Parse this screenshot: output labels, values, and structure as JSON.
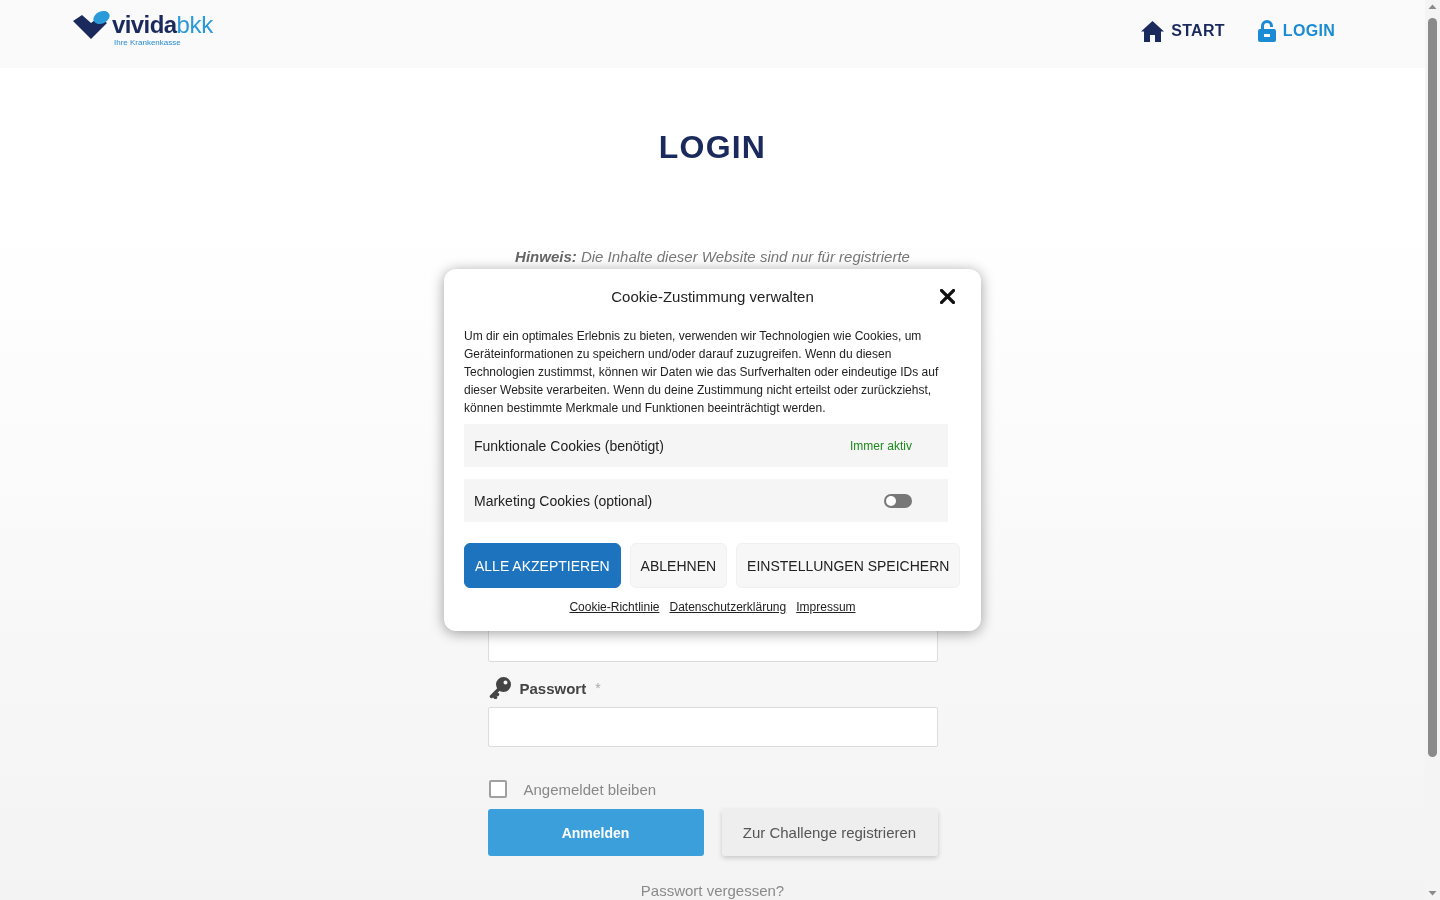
{
  "header": {
    "logo": {
      "wordmark": "**vivida**bkk",
      "tagline": "Ihre Krankenkasse"
    },
    "nav": [
      {
        "label": "START",
        "selected": false
      },
      {
        "label": "LOGIN",
        "selected": true
      }
    ]
  },
  "page": {
    "title": "LOGIN",
    "notice": "**Hinweis:** Die Inhalte dieser Website sind nur für registrierte",
    "fields": [
      {
        "kind": "text"
      },
      {
        "kind": "password",
        "label": "Passwort",
        "required_mark": "*"
      }
    ],
    "remember": {
      "label": "Angemeldet bleiben",
      "checked": false
    },
    "buttons": [
      {
        "label": "Anmelden",
        "kind": "primary"
      },
      {
        "label": "Zur Challenge registrieren",
        "kind": "secondary"
      }
    ],
    "forgot_link": "Passwort vergessen?"
  },
  "cookie_dialog": {
    "title": "Cookie-Zustimmung verwalten",
    "text": "Um dir ein optimales Erlebnis zu bieten, verwenden wir Technologien wie Cookies, um Geräteinformationen zu speichern und/oder darauf zuzugreifen. Wenn du diesen Technologien zustimmst, können wir Daten wie das Surfverhalten oder eindeutige IDs auf dieser Website verarbeiten. Wenn du deine Zustimmung nicht erteilst oder zurückziehst, können bestimmte Merkmale und Funktionen beeinträchtigt werden.",
    "categories": [
      {
        "label": "Funktionale Cookies (benötigt)",
        "kind": "always",
        "status": "Immer aktiv"
      },
      {
        "label": "Marketing Cookies (optional)",
        "kind": "toggle",
        "on": false
      }
    ],
    "buttons": [
      {
        "label": "ALLE AKZEPTIEREN",
        "kind": "primary"
      },
      {
        "label": "ABLEHNEN",
        "kind": "secondary"
      },
      {
        "label": "EINSTELLUNGEN SPEICHERN",
        "kind": "secondary"
      }
    ],
    "links": [
      "Cookie-Richtlinie",
      "Datenschutzerklärung",
      "Impressum"
    ]
  }
}
